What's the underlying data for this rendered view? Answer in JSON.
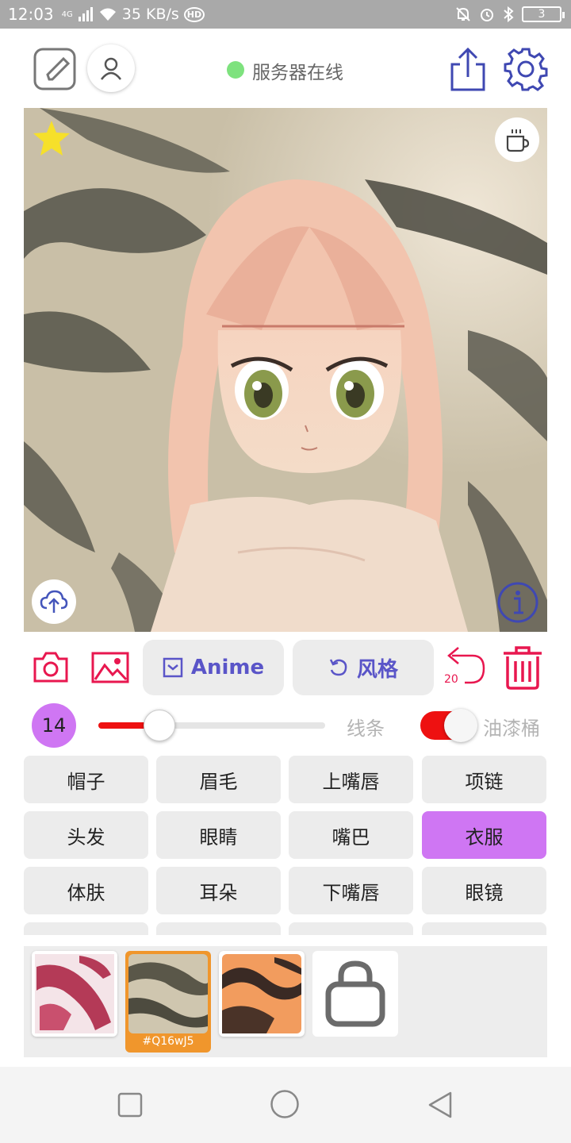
{
  "status_bar": {
    "time": "12:03",
    "network": "4G",
    "speed": "35 KB/s",
    "hd": "HD",
    "battery": "3"
  },
  "header": {
    "server_status": "服务器在线"
  },
  "tools": {
    "model_label": "Anime",
    "style_label": "风格",
    "undo_count": "20",
    "brush_size": "14",
    "slider_fraction": 0.27,
    "line_label": "线条",
    "bucket_label": "油漆桶",
    "bucket_on": true
  },
  "parts": [
    {
      "label": "帽子"
    },
    {
      "label": "眉毛"
    },
    {
      "label": "上嘴唇"
    },
    {
      "label": "项链"
    },
    {
      "label": "头发"
    },
    {
      "label": "眼睛"
    },
    {
      "label": "嘴巴"
    },
    {
      "label": "衣服"
    },
    {
      "label": "体肤"
    },
    {
      "label": "耳朵"
    },
    {
      "label": "下嘴唇"
    },
    {
      "label": "眼镜"
    }
  ],
  "selected_part": "衣服",
  "palette": {
    "selected_code": "#Q16wJ5"
  },
  "colors": {
    "accent_pink": "#e8174f",
    "accent_purple": "#5a55c8",
    "selected_purple": "#cf76f3",
    "palette_selected": "#f0962c",
    "online_green": "#7ee27e"
  },
  "icons": [
    "edit-icon",
    "user-icon",
    "share-icon",
    "settings-icon",
    "star-icon",
    "coffee-icon",
    "upload-cloud-icon",
    "info-icon",
    "camera-icon",
    "image-icon",
    "undo-icon",
    "trash-icon",
    "bag-icon"
  ]
}
